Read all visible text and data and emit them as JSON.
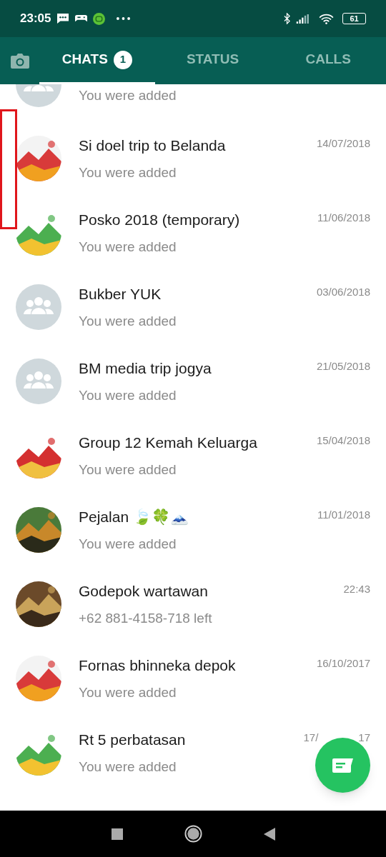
{
  "status_bar": {
    "time": "23:05",
    "battery": "61"
  },
  "tabs": [
    {
      "label": "CHATS",
      "selected": true,
      "badge": "1"
    },
    {
      "label": "STATUS",
      "selected": false
    },
    {
      "label": "CALLS",
      "selected": false
    }
  ],
  "chats": [
    {
      "kind": "group",
      "subtitle": "You were added"
    },
    {
      "kind": "picture",
      "name": "Si doel trip to Belanda",
      "time": "14/07/2018",
      "subtitle": "You were added"
    },
    {
      "kind": "picture",
      "name": "Posko 2018 (temporary)",
      "time": "11/06/2018",
      "subtitle": "You were added"
    },
    {
      "kind": "group",
      "name": "Bukber YUK",
      "time": "03/06/2018",
      "subtitle": "You were added"
    },
    {
      "kind": "group",
      "name": "BM media trip jogya",
      "time": "21/05/2018",
      "subtitle": "You were added"
    },
    {
      "kind": "picture",
      "name": "Group 12 Kemah Keluarga",
      "time": "15/04/2018",
      "subtitle": "You were added"
    },
    {
      "kind": "picture",
      "name": "Pejalan 🍃🍀🗻",
      "time": "11/01/2018",
      "subtitle": "You were added"
    },
    {
      "kind": "picture",
      "name": "Godepok wartawan",
      "time": "22:43",
      "subtitle": "+62 881-4158-718 left"
    },
    {
      "kind": "picture",
      "name": "Fornas bhinneka depok",
      "time": "16/10/2017",
      "subtitle": "You were added"
    },
    {
      "kind": "picture",
      "name": "Rt 5 perbatasan",
      "time": "17/",
      "time_end": "17",
      "subtitle": "You were added"
    }
  ]
}
